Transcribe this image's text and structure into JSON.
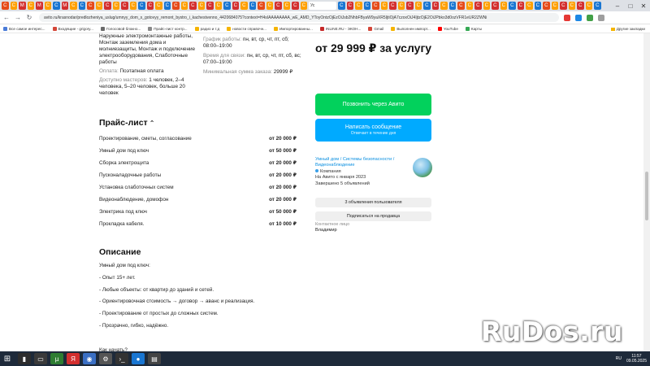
{
  "browser": {
    "active_tab_label": "Ус",
    "tab_icons": [
      "C",
      "C",
      "M",
      "C",
      "M",
      "C",
      "C",
      "M",
      "C",
      "C",
      "C",
      "C",
      "C",
      "C",
      "C",
      "C",
      "C",
      "C",
      "C",
      "C",
      "C",
      "C",
      "C",
      "C",
      "C",
      "C",
      "C",
      "C",
      "C",
      "C",
      "C",
      "C",
      "C",
      "C",
      "C",
      "C",
      "C",
      "C",
      "C",
      "C",
      "C",
      "C",
      "C",
      "C",
      "C",
      "C",
      "C",
      "C",
      "C",
      "C",
      "C",
      "C",
      "C",
      "C",
      "C",
      "C",
      "C",
      "C",
      "C",
      "C",
      "C",
      "C",
      "C",
      "C",
      "C",
      "C",
      "C"
    ],
    "url": "avito.ru/krasnodar/predlozheniya_uslug/umnyy_dom_s_gotovyy_remont_bystro_i_kachestvenno_4420684075?context=H4sIAAAAAAAA_wE_AMD_YToyOntzOjEzOiJsb2NhbFByaW9yaXR5IjtiOjA7czoxOiJ4IjtzOjE2OiJPbko3d0ozVFR1eUR2ZWNi",
    "bookmarks": [
      {
        "label": "Все самое интерес...",
        "color": "#4a7bd8"
      },
      {
        "label": "Входящие - grigory...",
        "color": "#d44638"
      },
      {
        "label": "Голосовой блокно...",
        "color": "#6a6a6a"
      },
      {
        "label": "Прайс-лист контр...",
        "color": "#888888"
      },
      {
        "label": "радио и т.д",
        "color": "#f5b400"
      },
      {
        "label": "новости справочн...",
        "color": "#f5b400"
      },
      {
        "label": "Импортированны...",
        "color": "#f5b400"
      },
      {
        "label": "INLINE.RU - ЭКОН...",
        "color": "#c62828"
      },
      {
        "label": "Gmail",
        "color": "#d44638"
      },
      {
        "label": "Выполнен импорт...",
        "color": "#f5b400"
      },
      {
        "label": "YouTube",
        "color": "#ff0000"
      },
      {
        "label": "Карты",
        "color": "#34a853"
      }
    ],
    "other_bookmarks": "Другие закладки"
  },
  "listing": {
    "services_text_1": "Наружные электромонтажные работы, Монтаж заземления дома и молниезащиты, Монтаж и подключение электрооборудования, Слаботочные работы",
    "payment_label": "Оплата:",
    "payment_value": "Поэтапная оплата",
    "masters_label": "Доступно мастеров:",
    "masters_value": "1 человек, 2–4 человека, 5–20 человек, больше 20 человек",
    "schedule_label": "График работы:",
    "schedule_value": "пн, вт, ср, чт, пт, сб; 08:00–19:00",
    "contact_time_label": "Время для связи:",
    "contact_time_value": "пн, вт, ср, чт, пт, сб, вс; 07:00–19:00",
    "min_order_label": "Минимальная сумма заказа:",
    "min_order_value": "29999 ₽",
    "price": "от 29 999 ₽ за услугу"
  },
  "actions": {
    "call_label": "Позвонить через Авито",
    "message_label": "Написать сообщение",
    "message_sub": "Отвечает в течение дня",
    "call_color": "#02d15c",
    "message_color": "#00aaff"
  },
  "seller": {
    "category": "Умный дом / Системы безопасности / Видеонаблюдение",
    "type": "Компания",
    "since": "На Авито с января 2023",
    "completed": "Завершено 5 объявлений",
    "listings_button": "3 объявления пользователя",
    "subscribe_button": "Подписаться на продавца",
    "contact_label": "Контактное лицо",
    "contact_name": "Владимир"
  },
  "pricelist": {
    "title": "Прайс-лист",
    "items": [
      {
        "name": "Проектирование, сметы, согласование",
        "price": "от 20 000 ₽"
      },
      {
        "name": "Умный дом под ключ",
        "price": "от 50 000 ₽"
      },
      {
        "name": "Сборка электрощита",
        "price": "от 20 000 ₽"
      },
      {
        "name": "Пусконаладочные работы",
        "price": "от 20 000 ₽"
      },
      {
        "name": "Установка слаботочных систем",
        "price": "от 20 000 ₽"
      },
      {
        "name": "Видеонаблюдение, домофон",
        "price": "от 20 000 ₽"
      },
      {
        "name": "Электрика под ключ",
        "price": "от 50 000 ₽"
      },
      {
        "name": "Прокладка кабеля.",
        "price": "от 10 000 ₽"
      }
    ]
  },
  "description": {
    "title": "Описание",
    "lines": [
      "Умный дом под ключ:",
      "- Опыт 15+ лет.",
      "- Любые объекты: от квартир до зданий и сетей.",
      "- Ориентировочная стоимость → договор → аванс и реализация.",
      "- Проектирование от простых до сложных систем.",
      "- Прозрачно, гибко, надёжно.",
      "",
      "Как начать?"
    ]
  },
  "taskbar": {
    "lang": "RU",
    "time": "11:57",
    "date": "09.05.2025"
  },
  "watermark": "RuDos.ru"
}
